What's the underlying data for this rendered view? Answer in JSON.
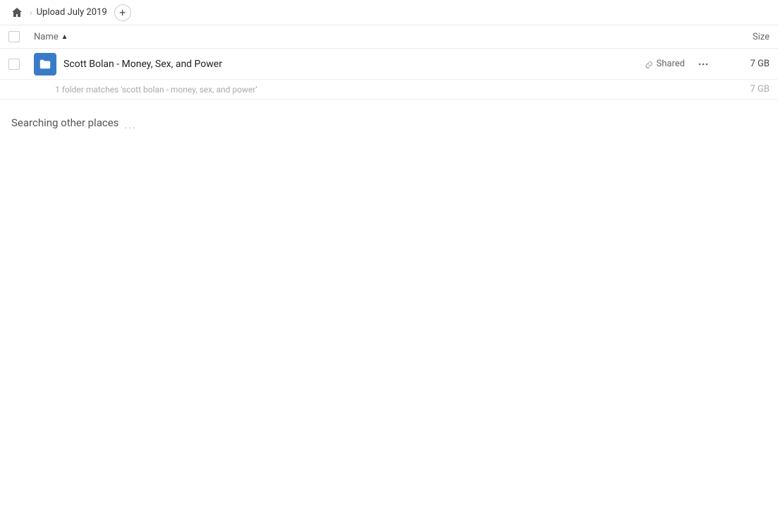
{
  "breadcrumb": {
    "home_label": "Home",
    "current_path": "Upload July 2019",
    "add_button_label": "+"
  },
  "columns": {
    "name_label": "Name",
    "sort_indicator": "▲",
    "size_label": "Size"
  },
  "file_row": {
    "name": "Scott Bolan - Money, Sex, and Power",
    "shared_label": "Shared",
    "more_label": "...",
    "size": "7 GB",
    "sub_text": "1 folder matches 'scott bolan - money, sex, and power'",
    "sub_size": "7 GB"
  },
  "searching": {
    "label": "Searching other places"
  },
  "icons": {
    "home": "🏠",
    "link": "🔗",
    "folder": "📁"
  }
}
